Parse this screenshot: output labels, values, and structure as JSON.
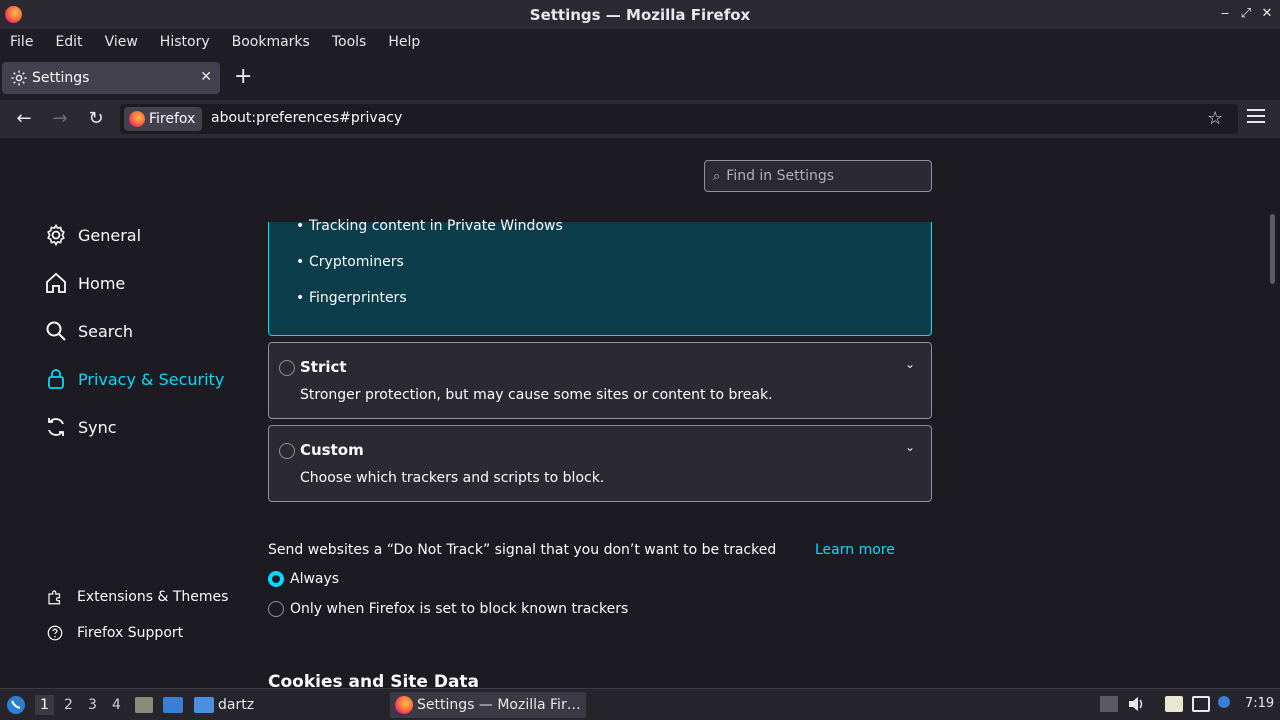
{
  "window": {
    "title": "Settings — Mozilla Firefox",
    "controls": [
      "‒",
      "⤢",
      "✕"
    ]
  },
  "menu": [
    "File",
    "Edit",
    "View",
    "History",
    "Bookmarks",
    "Tools",
    "Help"
  ],
  "tab": {
    "label": "Settings",
    "close": "✕",
    "new_tab": "+"
  },
  "nav": {
    "back": "←",
    "forward": "→",
    "reload": "↻",
    "identity_label": "Firefox",
    "url": "about:preferences#privacy",
    "bookmark": "☆"
  },
  "search": {
    "placeholder": "Find in Settings",
    "icon": "⌕"
  },
  "sidebar": {
    "items": [
      {
        "label": "General",
        "icon": "gear-icon"
      },
      {
        "label": "Home",
        "icon": "home-icon"
      },
      {
        "label": "Search",
        "icon": "search-icon"
      },
      {
        "label": "Privacy & Security",
        "icon": "lock-icon",
        "active": true
      },
      {
        "label": "Sync",
        "icon": "sync-icon"
      }
    ],
    "footer": [
      {
        "label": "Extensions & Themes",
        "icon": "puzzle-icon"
      },
      {
        "label": "Firefox Support",
        "icon": "help-icon"
      }
    ]
  },
  "standard": {
    "bullets": [
      "Tracking content in Private Windows",
      "Cryptominers",
      "Fingerprinters"
    ]
  },
  "options": [
    {
      "title": "Strict",
      "desc": "Stronger protection, but may cause some sites or content to break.",
      "chevron": "⌄"
    },
    {
      "title": "Custom",
      "desc": "Choose which trackers and scripts to block.",
      "chevron": "⌄"
    }
  ],
  "dnt": {
    "text": "Send websites a “Do Not Track” signal that you don’t want to be tracked",
    "learn_more": "Learn more",
    "choices": [
      {
        "label": "Always",
        "selected": true
      },
      {
        "label": "Only when Firefox is set to block known trackers",
        "selected": false
      }
    ]
  },
  "next_section": "Cookies and Site Data",
  "taskbar": {
    "workspaces": [
      "1",
      "2",
      "3",
      "4"
    ],
    "folder_label": "dartz",
    "active_task": "Settings — Mozilla Fir…",
    "clock": "7:19"
  },
  "colors": {
    "accent": "#00ddff",
    "background": "#1c1b22",
    "panel": "#2b2a33",
    "selected_box": "#0b3d4b"
  }
}
